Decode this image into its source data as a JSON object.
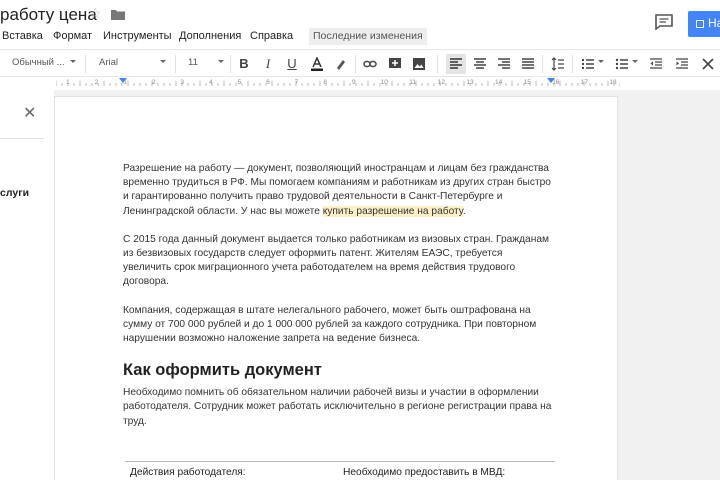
{
  "document": {
    "title": "работу цена"
  },
  "header": {
    "share_label": "На"
  },
  "menu": {
    "items": [
      "Вставка",
      "Формат",
      "Инструменты",
      "Дополнения",
      "Справка"
    ],
    "last_edit": "Последние изменения"
  },
  "toolbar": {
    "style": "Обычный ...",
    "font": "Arial",
    "size": "11"
  },
  "ruler": {
    "labels": [
      "1",
      "2",
      "1",
      "2",
      "3",
      "4",
      "5",
      "6",
      "7",
      "8",
      "9",
      "10",
      "11",
      "12",
      "13",
      "14",
      "15",
      "16",
      "17",
      "18"
    ]
  },
  "outline_panel": {
    "item": "слуги"
  },
  "content": {
    "p1_text": "Разрешение на работу — документ, позволяющий иностранцам и лицам без гражданства временно трудиться в РФ. Мы помогаем компаниям и работникам из других стран быстро и гарантированно получить право трудовой деятельности в Санкт-Петербурге и Ленинградской области. У нас вы можете ",
    "p1_link": "купить разрешение на работу",
    "p1_end": ".",
    "p2": "С 2015 года данный документ выдается только работникам из визовых стран. Гражданам из безвизовых государств следует оформить патент. Жителям ЕАЭС, требуется увеличить срок миграционного учета работодателем на время действия трудового договора.",
    "p3": "Компания, содержащая в штате нелегального рабочего, может быть оштрафована на сумму от 700 000 рублей и до 1 000 000 рублей за каждого сотрудника. При повторном нарушении возможно наложение запрета на ведение бизнеса.",
    "heading": "Как оформить документ",
    "p4": "Необходимо помнить об обязательном наличии рабочей визы и участии в оформлении работодателя. Сотрудник может работать исключительно в регионе регистрации права на труд.",
    "table_col1": "Действия работодателя:",
    "table_col2": "Необходимо предоставить в МВД:"
  },
  "colors": {
    "share_button": "#4285f4",
    "highlight": "#fdf0c6",
    "toolbar_active": "#e4e4e4"
  }
}
